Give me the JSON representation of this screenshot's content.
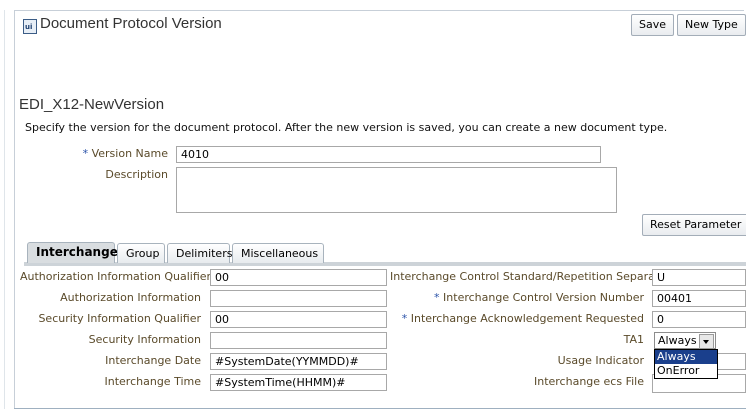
{
  "header": {
    "title": "Document Protocol Version",
    "icon_text": "ui"
  },
  "toolbar": {
    "save_label": "Save",
    "new_type_label": "New Type"
  },
  "section": {
    "heading": "EDI_X12-NewVersion",
    "description": "Specify the version for the document protocol. After the new version is saved, you can create a new document type."
  },
  "form": {
    "version_name": {
      "label": "Version Name",
      "required_mark": "*",
      "value": "4010"
    },
    "description": {
      "label": "Description",
      "value": ""
    },
    "reset_label": "Reset Parameter"
  },
  "tabs": [
    {
      "label": "Interchange",
      "active": true
    },
    {
      "label": "Group",
      "active": false
    },
    {
      "label": "Delimiters",
      "active": false
    },
    {
      "label": "Miscellaneous",
      "active": false
    }
  ],
  "interchange": {
    "left": [
      {
        "label": "Authorization Information Qualifier",
        "value": "00"
      },
      {
        "label": "Authorization Information",
        "value": ""
      },
      {
        "label": "Security Information Qualifier",
        "value": "00"
      },
      {
        "label": "Security Information",
        "value": ""
      },
      {
        "label": "Interchange Date",
        "value": "#SystemDate(YYMMDD)#"
      },
      {
        "label": "Interchange Time",
        "value": "#SystemTime(HHMM)#"
      }
    ],
    "right": [
      {
        "label": "Interchange Control Standard/Repetition Separator",
        "value": "U"
      },
      {
        "label": "Interchange Control Version Number",
        "required_mark": "*",
        "value": "00401"
      },
      {
        "label": "Interchange Acknowledgement Requested",
        "required_mark": "*",
        "value": "0"
      },
      {
        "label": "TA1",
        "value": "Always"
      },
      {
        "label": "Usage Indicator",
        "value": ""
      },
      {
        "label": "Interchange ecs File",
        "value": ""
      }
    ],
    "ta1_options": [
      "Always",
      "OnError"
    ]
  }
}
